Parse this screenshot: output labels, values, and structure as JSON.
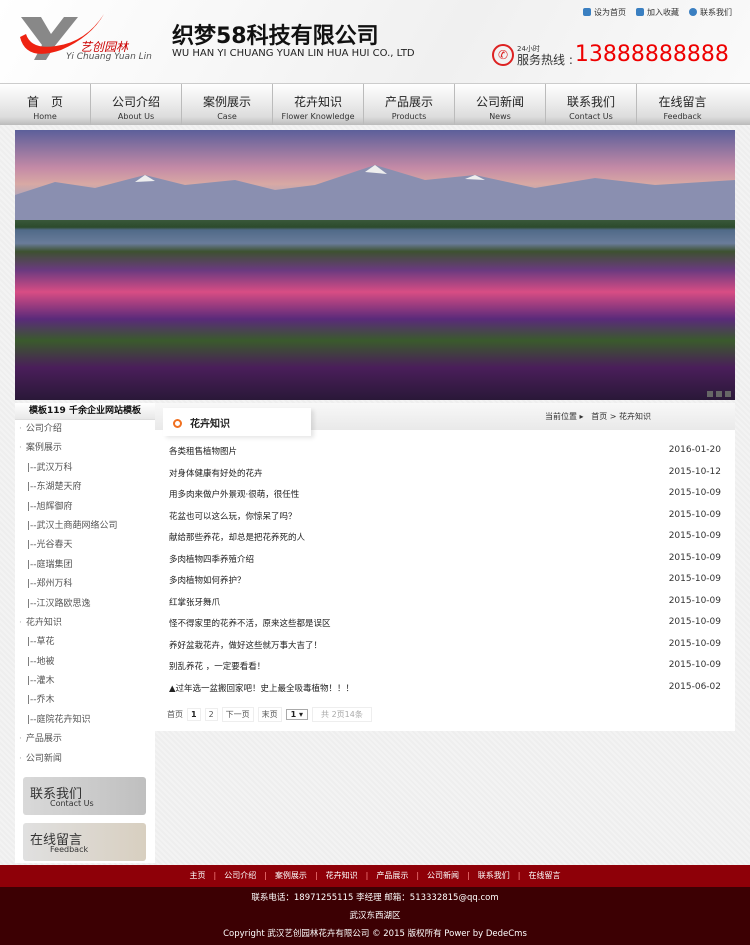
{
  "header": {
    "logo_cn": "艺创园林",
    "logo_en": "Yi Chuang Yuan Lin",
    "company": "织梦58科技有限公司",
    "company_en": "WU HAN YI CHUANG YUAN LIN HUA HUI CO., LTD",
    "top_links": [
      "设为首页",
      "加入收藏",
      "联系我们"
    ],
    "hotline_small": "24小时",
    "hotline_label": "服务热线 :",
    "hotline": "13888888888"
  },
  "nav": [
    {
      "cn": "首　页",
      "en": "Home"
    },
    {
      "cn": "公司介绍",
      "en": "About Us"
    },
    {
      "cn": "案例展示",
      "en": "Case"
    },
    {
      "cn": "花卉知识",
      "en": "Flower Knowledge"
    },
    {
      "cn": "产品展示",
      "en": "Products"
    },
    {
      "cn": "公司新闻",
      "en": "News"
    },
    {
      "cn": "联系我们",
      "en": "Contact Us"
    },
    {
      "cn": "在线留言",
      "en": "Feedback"
    }
  ],
  "sidebar": {
    "title": "模板119 千余企业网站模板",
    "items": [
      {
        "label": "公司介绍",
        "level": 0
      },
      {
        "label": "案例展示",
        "level": 0
      },
      {
        "label": "|--武汉万科",
        "level": 1
      },
      {
        "label": "|--东湖楚天府",
        "level": 1
      },
      {
        "label": "|--旭辉御府",
        "level": 1
      },
      {
        "label": "|--武汉土商葩网络公司",
        "level": 1
      },
      {
        "label": "|--光谷春天",
        "level": 1
      },
      {
        "label": "|--庭瑞集团",
        "level": 1
      },
      {
        "label": "|--郑州万科",
        "level": 1
      },
      {
        "label": "|--江汉路欧思逸",
        "level": 1
      },
      {
        "label": "花卉知识",
        "level": 0
      },
      {
        "label": "|--草花",
        "level": 1
      },
      {
        "label": "|--地被",
        "level": 1
      },
      {
        "label": "|--灌木",
        "level": 1
      },
      {
        "label": "|--乔木",
        "level": 1
      },
      {
        "label": "|--庭院花卉知识",
        "level": 1
      },
      {
        "label": "产品展示",
        "level": 0
      },
      {
        "label": "公司新闻",
        "level": 0
      }
    ],
    "ads": [
      {
        "cn": "联系我们",
        "en": "Contact Us"
      },
      {
        "cn": "在线留言",
        "en": "Feedback"
      }
    ]
  },
  "main": {
    "tab": "花卉知识",
    "crumb_label": "当前位置 ▸",
    "crumb_path": "首页 > 花卉知识",
    "articles": [
      {
        "t": "各类租售植物图片",
        "d": "2016-01-20"
      },
      {
        "t": "对身体健康有好处的花卉",
        "d": "2015-10-12"
      },
      {
        "t": "用多肉来做户外景观·很萌，很任性",
        "d": "2015-10-09"
      },
      {
        "t": "花盆也可以这么玩，你惊呆了吗？",
        "d": "2015-10-09"
      },
      {
        "t": "献给那些养花，却总是把花养死的人",
        "d": "2015-10-09"
      },
      {
        "t": "多肉植物四季养殖介绍",
        "d": "2015-10-09"
      },
      {
        "t": "多肉植物如何养护？",
        "d": "2015-10-09"
      },
      {
        "t": "红掌张牙舞爪",
        "d": "2015-10-09"
      },
      {
        "t": "怪不得家里的花养不活，原来这些都是误区",
        "d": "2015-10-09"
      },
      {
        "t": "养好盆栽花卉，做好这些就万事大吉了！",
        "d": "2015-10-09"
      },
      {
        "t": "别乱养花 ，一定要看看！",
        "d": "2015-10-09"
      },
      {
        "t": "▲过年选一盆搬回家吧！史上最全吸毒植物！！！",
        "d": "2015-06-02"
      }
    ],
    "pager": {
      "first": "首页",
      "p1": "1",
      "p2": "2",
      "next": "下一页",
      "last": "末页",
      "select": "1 ▾",
      "total": "共 2页14条"
    }
  },
  "footer": {
    "links": [
      "主页",
      "公司介绍",
      "案例展示",
      "花卉知识",
      "产品展示",
      "公司新闻",
      "联系我们",
      "在线留言"
    ],
    "contact": "联系电话：18971255115  李经理  邮箱：513332815@qq.com",
    "address": "武汉东西湖区",
    "copyright": "Copyright 武汉艺创园林花卉有限公司 © 2015 版权所有 Power by DedeCms"
  }
}
